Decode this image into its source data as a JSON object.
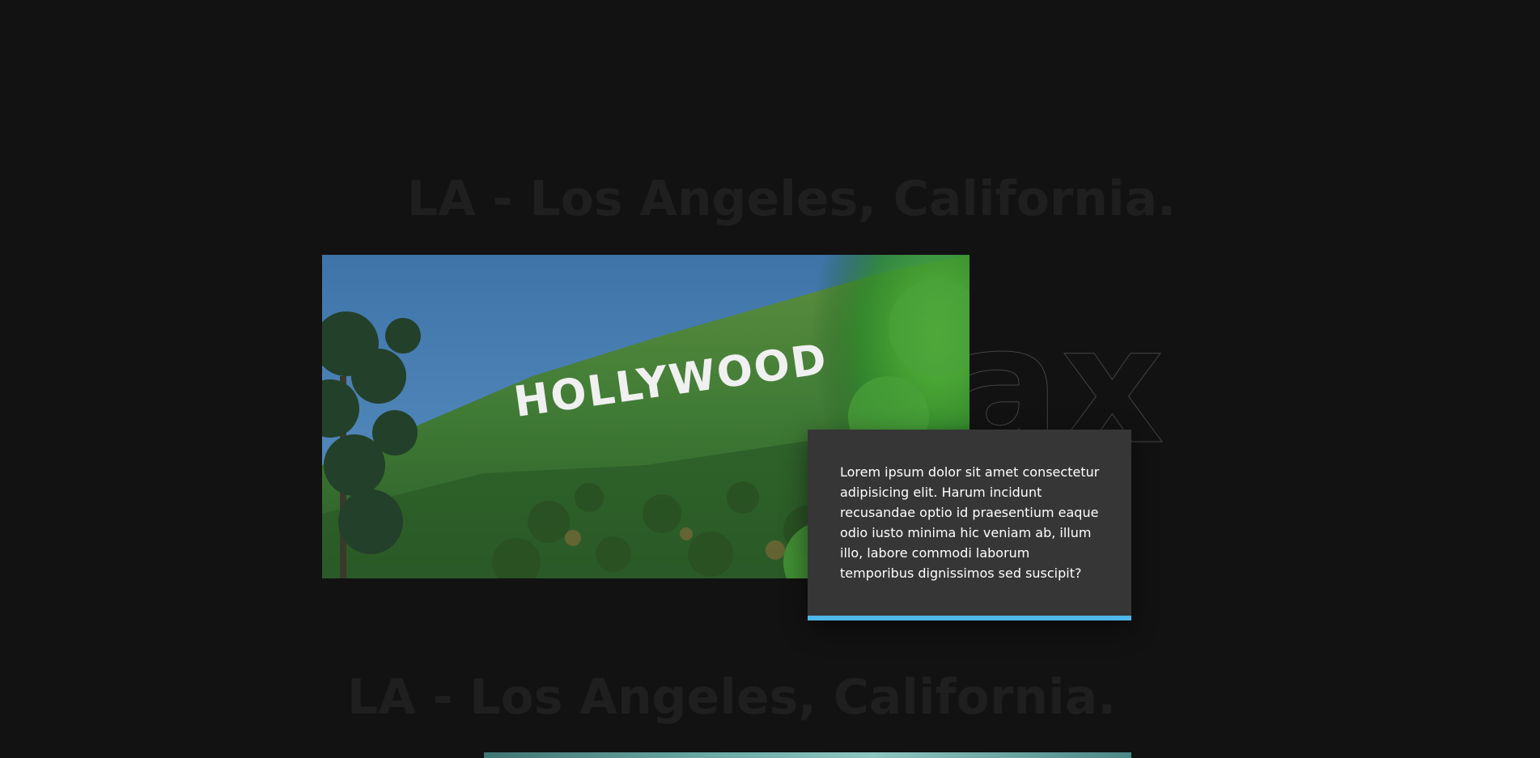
{
  "sections": [
    {
      "headline": "LA - Los Angeles, California.",
      "photo_sign": "HOLLYWOOD",
      "outline_word": "ax",
      "card_text": "Lorem ipsum dolor sit amet consectetur adipisicing elit. Harum incidunt recusandae optio id praesentium eaque odio iusto minima hic veniam ab, illum illo, labore commodi laborum temporibus dignissimos sed suscipit?"
    },
    {
      "headline": "LA - Los Angeles, California."
    }
  ],
  "colors": {
    "background": "#121212",
    "headline": "#1f1f1f",
    "card": "#363636",
    "accent": "#4fb8ea"
  }
}
